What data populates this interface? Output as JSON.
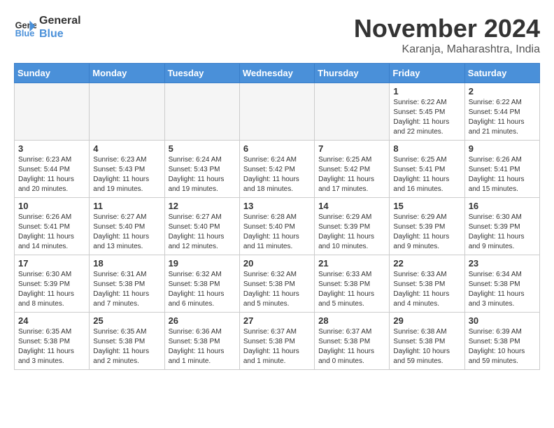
{
  "logo": {
    "line1": "General",
    "line2": "Blue"
  },
  "title": "November 2024",
  "location": "Karanja, Maharashtra, India",
  "days_of_week": [
    "Sunday",
    "Monday",
    "Tuesday",
    "Wednesday",
    "Thursday",
    "Friday",
    "Saturday"
  ],
  "weeks": [
    [
      {
        "day": "",
        "info": "",
        "empty": true
      },
      {
        "day": "",
        "info": "",
        "empty": true
      },
      {
        "day": "",
        "info": "",
        "empty": true
      },
      {
        "day": "",
        "info": "",
        "empty": true
      },
      {
        "day": "",
        "info": "",
        "empty": true
      },
      {
        "day": "1",
        "info": "Sunrise: 6:22 AM\nSunset: 5:45 PM\nDaylight: 11 hours\nand 22 minutes.",
        "empty": false
      },
      {
        "day": "2",
        "info": "Sunrise: 6:22 AM\nSunset: 5:44 PM\nDaylight: 11 hours\nand 21 minutes.",
        "empty": false
      }
    ],
    [
      {
        "day": "3",
        "info": "Sunrise: 6:23 AM\nSunset: 5:44 PM\nDaylight: 11 hours\nand 20 minutes.",
        "empty": false
      },
      {
        "day": "4",
        "info": "Sunrise: 6:23 AM\nSunset: 5:43 PM\nDaylight: 11 hours\nand 19 minutes.",
        "empty": false
      },
      {
        "day": "5",
        "info": "Sunrise: 6:24 AM\nSunset: 5:43 PM\nDaylight: 11 hours\nand 19 minutes.",
        "empty": false
      },
      {
        "day": "6",
        "info": "Sunrise: 6:24 AM\nSunset: 5:42 PM\nDaylight: 11 hours\nand 18 minutes.",
        "empty": false
      },
      {
        "day": "7",
        "info": "Sunrise: 6:25 AM\nSunset: 5:42 PM\nDaylight: 11 hours\nand 17 minutes.",
        "empty": false
      },
      {
        "day": "8",
        "info": "Sunrise: 6:25 AM\nSunset: 5:41 PM\nDaylight: 11 hours\nand 16 minutes.",
        "empty": false
      },
      {
        "day": "9",
        "info": "Sunrise: 6:26 AM\nSunset: 5:41 PM\nDaylight: 11 hours\nand 15 minutes.",
        "empty": false
      }
    ],
    [
      {
        "day": "10",
        "info": "Sunrise: 6:26 AM\nSunset: 5:41 PM\nDaylight: 11 hours\nand 14 minutes.",
        "empty": false
      },
      {
        "day": "11",
        "info": "Sunrise: 6:27 AM\nSunset: 5:40 PM\nDaylight: 11 hours\nand 13 minutes.",
        "empty": false
      },
      {
        "day": "12",
        "info": "Sunrise: 6:27 AM\nSunset: 5:40 PM\nDaylight: 11 hours\nand 12 minutes.",
        "empty": false
      },
      {
        "day": "13",
        "info": "Sunrise: 6:28 AM\nSunset: 5:40 PM\nDaylight: 11 hours\nand 11 minutes.",
        "empty": false
      },
      {
        "day": "14",
        "info": "Sunrise: 6:29 AM\nSunset: 5:39 PM\nDaylight: 11 hours\nand 10 minutes.",
        "empty": false
      },
      {
        "day": "15",
        "info": "Sunrise: 6:29 AM\nSunset: 5:39 PM\nDaylight: 11 hours\nand 9 minutes.",
        "empty": false
      },
      {
        "day": "16",
        "info": "Sunrise: 6:30 AM\nSunset: 5:39 PM\nDaylight: 11 hours\nand 9 minutes.",
        "empty": false
      }
    ],
    [
      {
        "day": "17",
        "info": "Sunrise: 6:30 AM\nSunset: 5:39 PM\nDaylight: 11 hours\nand 8 minutes.",
        "empty": false
      },
      {
        "day": "18",
        "info": "Sunrise: 6:31 AM\nSunset: 5:38 PM\nDaylight: 11 hours\nand 7 minutes.",
        "empty": false
      },
      {
        "day": "19",
        "info": "Sunrise: 6:32 AM\nSunset: 5:38 PM\nDaylight: 11 hours\nand 6 minutes.",
        "empty": false
      },
      {
        "day": "20",
        "info": "Sunrise: 6:32 AM\nSunset: 5:38 PM\nDaylight: 11 hours\nand 5 minutes.",
        "empty": false
      },
      {
        "day": "21",
        "info": "Sunrise: 6:33 AM\nSunset: 5:38 PM\nDaylight: 11 hours\nand 5 minutes.",
        "empty": false
      },
      {
        "day": "22",
        "info": "Sunrise: 6:33 AM\nSunset: 5:38 PM\nDaylight: 11 hours\nand 4 minutes.",
        "empty": false
      },
      {
        "day": "23",
        "info": "Sunrise: 6:34 AM\nSunset: 5:38 PM\nDaylight: 11 hours\nand 3 minutes.",
        "empty": false
      }
    ],
    [
      {
        "day": "24",
        "info": "Sunrise: 6:35 AM\nSunset: 5:38 PM\nDaylight: 11 hours\nand 3 minutes.",
        "empty": false
      },
      {
        "day": "25",
        "info": "Sunrise: 6:35 AM\nSunset: 5:38 PM\nDaylight: 11 hours\nand 2 minutes.",
        "empty": false
      },
      {
        "day": "26",
        "info": "Sunrise: 6:36 AM\nSunset: 5:38 PM\nDaylight: 11 hours\nand 1 minute.",
        "empty": false
      },
      {
        "day": "27",
        "info": "Sunrise: 6:37 AM\nSunset: 5:38 PM\nDaylight: 11 hours\nand 1 minute.",
        "empty": false
      },
      {
        "day": "28",
        "info": "Sunrise: 6:37 AM\nSunset: 5:38 PM\nDaylight: 11 hours\nand 0 minutes.",
        "empty": false
      },
      {
        "day": "29",
        "info": "Sunrise: 6:38 AM\nSunset: 5:38 PM\nDaylight: 10 hours\nand 59 minutes.",
        "empty": false
      },
      {
        "day": "30",
        "info": "Sunrise: 6:39 AM\nSunset: 5:38 PM\nDaylight: 10 hours\nand 59 minutes.",
        "empty": false
      }
    ]
  ]
}
